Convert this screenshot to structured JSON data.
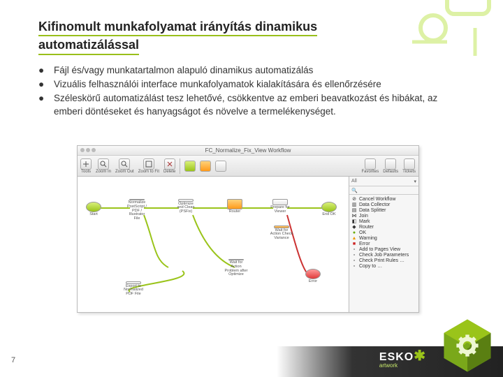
{
  "title_line1": "Kifinomult munkafolyamat irányítás dinamikus",
  "title_line2": "automatizálással",
  "bullets": [
    "Fájl és/vagy munkatartalmon alapuló dinamikus automatizálás",
    "Vizuális felhasználói interface munkafolyamatok kialakítására és ellenőrzésére",
    "Széleskörű automatizálást tesz lehetővé, csökkentve az emberi beavatkozást és hibákat, az emberi döntéseket és hanyagságot és növelve a termelékenységet."
  ],
  "page_number": "7",
  "footer_brand": "ESKO",
  "footer_sub": "artwork",
  "screenshot": {
    "window_title": "FC_Normalize_Fix_View    Workflow",
    "toolbar": [
      {
        "label": "Tools"
      },
      {
        "label": "Zoom In"
      },
      {
        "label": "Zoom Out"
      },
      {
        "label": "Zoom to Fit"
      },
      {
        "label": "Delete"
      }
    ],
    "toolbar_right": [
      {
        "label": "Favorites"
      },
      {
        "label": "Defaults"
      },
      {
        "label": "Tickets"
      }
    ],
    "filter_label": "All",
    "side_items": [
      "Cancel Workflow",
      "Data Collector",
      "Data Splitter",
      "Join",
      "Mark",
      "Router",
      "OK",
      "Warning",
      "Error",
      "Add to Pages View",
      "Check Job Parameters",
      "Check Print Rules …",
      "Copy to …"
    ],
    "nodes": {
      "start": "Start",
      "n1": "Normalize PostScript / PDF / Illustrator File",
      "n2": "Optimize and Clean (PSFix)",
      "n3": "Router",
      "n4": "Prepare for Viewer",
      "n5": "Wait for Action Check Variance",
      "n6": "Wait for Action Problem after Optimize",
      "n7": "Export to Normalized PDF File",
      "end": "End OK",
      "err": "Error"
    }
  }
}
